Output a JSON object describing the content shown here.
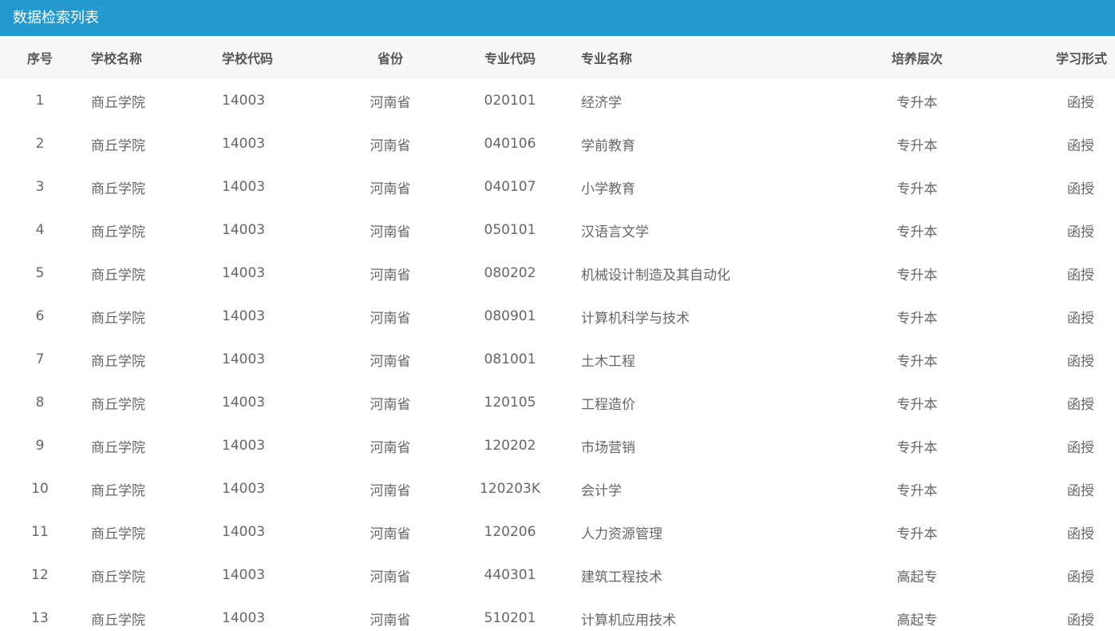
{
  "panel": {
    "title": "数据检索列表",
    "accent_color": "#2399cf"
  },
  "table": {
    "headers": [
      "序号",
      "学校名称",
      "学校代码",
      "省份",
      "专业代码",
      "专业名称",
      "培养层次",
      "学习形式"
    ],
    "rows": [
      [
        "1",
        "商丘学院",
        "14003",
        "河南省",
        "020101",
        "经济学",
        "专升本",
        "函授"
      ],
      [
        "2",
        "商丘学院",
        "14003",
        "河南省",
        "040106",
        "学前教育",
        "专升本",
        "函授"
      ],
      [
        "3",
        "商丘学院",
        "14003",
        "河南省",
        "040107",
        "小学教育",
        "专升本",
        "函授"
      ],
      [
        "4",
        "商丘学院",
        "14003",
        "河南省",
        "050101",
        "汉语言文学",
        "专升本",
        "函授"
      ],
      [
        "5",
        "商丘学院",
        "14003",
        "河南省",
        "080202",
        "机械设计制造及其自动化",
        "专升本",
        "函授"
      ],
      [
        "6",
        "商丘学院",
        "14003",
        "河南省",
        "080901",
        "计算机科学与技术",
        "专升本",
        "函授"
      ],
      [
        "7",
        "商丘学院",
        "14003",
        "河南省",
        "081001",
        "土木工程",
        "专升本",
        "函授"
      ],
      [
        "8",
        "商丘学院",
        "14003",
        "河南省",
        "120105",
        "工程造价",
        "专升本",
        "函授"
      ],
      [
        "9",
        "商丘学院",
        "14003",
        "河南省",
        "120202",
        "市场营销",
        "专升本",
        "函授"
      ],
      [
        "10",
        "商丘学院",
        "14003",
        "河南省",
        "120203K",
        "会计学",
        "专升本",
        "函授"
      ],
      [
        "11",
        "商丘学院",
        "14003",
        "河南省",
        "120206",
        "人力资源管理",
        "专升本",
        "函授"
      ],
      [
        "12",
        "商丘学院",
        "14003",
        "河南省",
        "440301",
        "建筑工程技术",
        "高起专",
        "函授"
      ],
      [
        "13",
        "商丘学院",
        "14003",
        "河南省",
        "510201",
        "计算机应用技术",
        "高起专",
        "函授"
      ]
    ]
  }
}
